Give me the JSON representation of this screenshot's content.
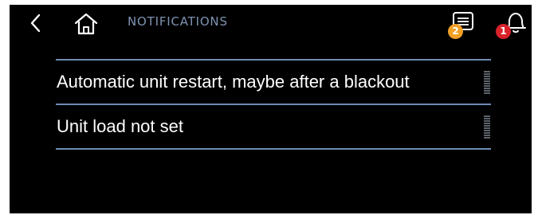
{
  "header": {
    "title": "NOTIFICATIONS",
    "back_icon": "chevron-left-icon",
    "home_icon": "home-icon",
    "messages": {
      "icon": "message-icon",
      "badge": "2",
      "badge_color": "#f2a024"
    },
    "alarms": {
      "icon": "bell-icon",
      "badge": "1",
      "badge_color": "#d9232b"
    }
  },
  "notifications": [
    {
      "text": "Automatic unit restart, maybe after a blackout",
      "handle_icon": "drag-handle-icon"
    },
    {
      "text": "Unit load not set",
      "handle_icon": "drag-handle-icon"
    }
  ],
  "colors": {
    "background": "#000000",
    "accent": "#6d8cb5",
    "title": "#7f93b2",
    "text": "#ffffff"
  }
}
